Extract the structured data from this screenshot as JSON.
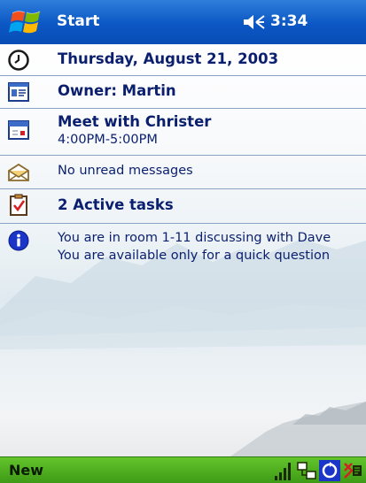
{
  "titlebar": {
    "start_label": "Start",
    "time": "3:34",
    "speaker_icon": "speaker-volume-icon",
    "logo_icon": "windows-flag-icon"
  },
  "today": {
    "date": "Thursday, August 21, 2003",
    "owner": "Owner: Martin",
    "appointment": {
      "title": "Meet with Christer",
      "time": "4:00PM-5:00PM"
    },
    "messages": "No unread messages",
    "tasks": "2 Active tasks",
    "info": {
      "line1": "You are in room 1-11 discussing with Dave",
      "line2": "You are available only for a quick question"
    }
  },
  "bottombar": {
    "new_label": "New",
    "tray_icons": [
      "signal-strength-icon",
      "network-connection-icon",
      "sync-icon",
      "status-icon"
    ]
  },
  "colors": {
    "titlebar": "#0b57c4",
    "bottombar": "#4cae1f",
    "text": "#0a1f6e",
    "separator": "#8aa2c4"
  }
}
